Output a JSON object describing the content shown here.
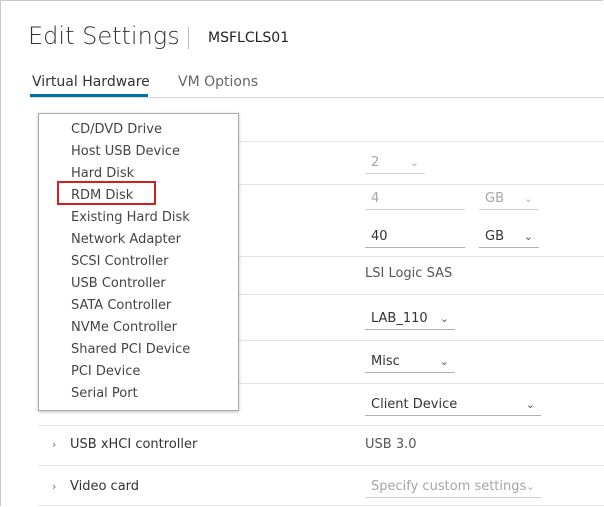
{
  "header": {
    "title": "Edit Settings",
    "vm_name": "MSFLCLS01"
  },
  "tabs": [
    {
      "label": "Virtual Hardware",
      "active": true
    },
    {
      "label": "VM Options",
      "active": false
    }
  ],
  "menu": {
    "items": [
      {
        "label": "CD/DVD Drive"
      },
      {
        "label": "Host USB Device"
      },
      {
        "label": "Hard Disk"
      },
      {
        "label": "RDM Disk",
        "highlighted": true
      },
      {
        "label": "Existing Hard Disk"
      },
      {
        "label": "Network Adapter"
      },
      {
        "label": "SCSI Controller"
      },
      {
        "label": "USB Controller"
      },
      {
        "label": "SATA Controller"
      },
      {
        "label": "NVMe Controller"
      },
      {
        "label": "Shared PCI Device"
      },
      {
        "label": "PCI Device"
      },
      {
        "label": "Serial Port"
      }
    ]
  },
  "hardware": {
    "cpu": {
      "value": "2"
    },
    "memory": {
      "value": "4",
      "unit": "GB"
    },
    "hard_disk": {
      "value": "40",
      "unit": "GB"
    },
    "scsi_controller": {
      "value": "LSI Logic SAS"
    },
    "network": {
      "value": "LAB_110"
    },
    "cd_dvd": {
      "value": "Misc"
    },
    "device": {
      "value": "Client Device"
    },
    "usb": {
      "label": "USB xHCI controller",
      "value": "USB 3.0"
    },
    "video": {
      "label": "Video card",
      "value": "Specify custom settings"
    }
  },
  "colors": {
    "accent": "#0072a3",
    "highlight": "#d12020"
  },
  "icons": {
    "expand": "chevron-right-icon",
    "dropdown": "chevron-down-icon"
  }
}
